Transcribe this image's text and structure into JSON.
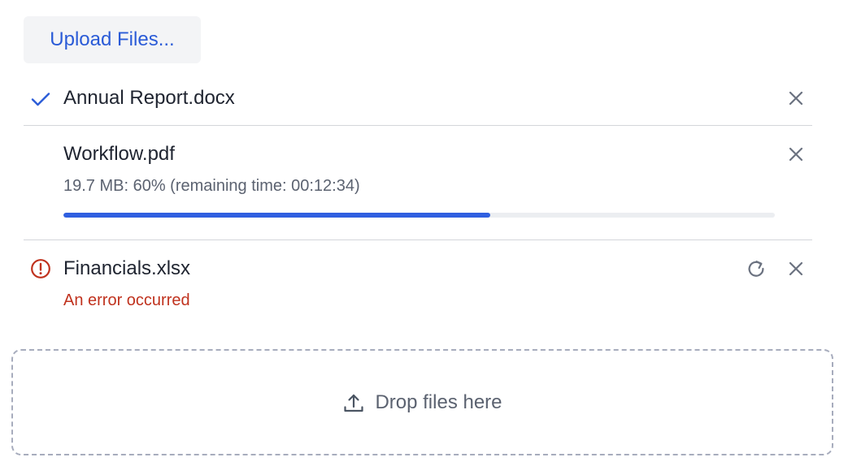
{
  "upload_button": {
    "label": "Upload Files..."
  },
  "files": [
    {
      "name": "Annual Report.docx",
      "status": "complete",
      "status_icon": "check-icon"
    },
    {
      "name": "Workflow.pdf",
      "status": "uploading",
      "meta": "19.7 MB: 60% (remaining time: 00:12:34)",
      "progress": 0.6
    },
    {
      "name": "Financials.xlsx",
      "status": "error",
      "status_icon": "error-circle-icon",
      "error": "An error occurred"
    }
  ],
  "drop_zone": {
    "label": "Drop files here",
    "icon": "upload-icon"
  },
  "colors": {
    "accent": "#2a5bd7",
    "progress": "#2f5fe0",
    "error": "#c0321e",
    "muted": "#5b6270",
    "button_bg": "#f3f4f6"
  }
}
